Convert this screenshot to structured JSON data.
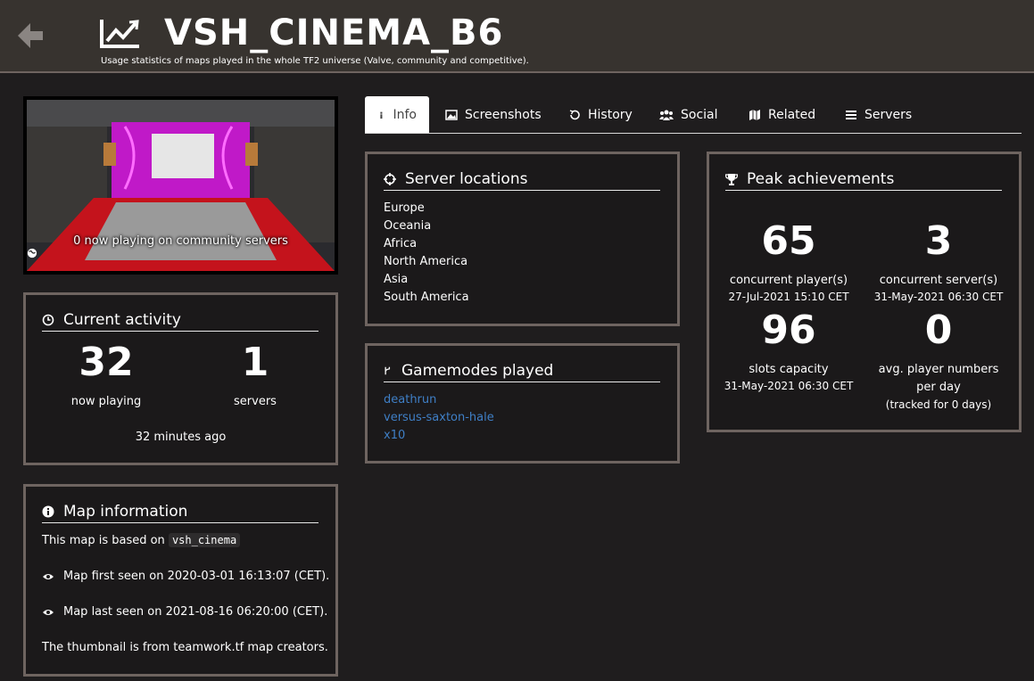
{
  "header": {
    "title": "VSH_CINEMA_B6",
    "subtitle": "Usage statistics of maps played in the whole TF2 universe (Valve, community and competitive).",
    "back_icon": "arrow-left-icon",
    "logo_icon": "line-chart-icon"
  },
  "thumbnail": {
    "caption": "0 now playing on community servers",
    "caption_icon": "globe-icon"
  },
  "current_activity": {
    "title": "Current activity",
    "players_value": "32",
    "players_label": "now playing",
    "servers_value": "1",
    "servers_label": "servers",
    "updated": "32 minutes ago"
  },
  "map_info": {
    "title": "Map information",
    "based_on_prefix": "This map is based on",
    "based_on": "vsh_cinema",
    "first_seen": "Map first seen on 2020-03-01 16:13:07 (CET).",
    "last_seen": "Map last seen on 2021-08-16 06:20:00 (CET).",
    "thumbnail_credit": "The thumbnail is from teamwork.tf map creators."
  },
  "tabs": [
    {
      "label": "Info",
      "icon": "info-icon",
      "active": true
    },
    {
      "label": "Screenshots",
      "icon": "image-icon"
    },
    {
      "label": "History",
      "icon": "history-icon"
    },
    {
      "label": "Social",
      "icon": "users-icon"
    },
    {
      "label": "Related",
      "icon": "map-icon"
    },
    {
      "label": "Servers",
      "icon": "server-list-icon"
    }
  ],
  "server_locations": {
    "title": "Server locations",
    "items": [
      "Europe",
      "Oceania",
      "Africa",
      "North America",
      "Asia",
      "South America"
    ]
  },
  "gamemodes": {
    "title": "Gamemodes played",
    "items": [
      "deathrun",
      "versus-saxton-hale",
      "x10"
    ]
  },
  "peak": {
    "title": "Peak achievements",
    "concurrent_players": {
      "value": "65",
      "label": "concurrent player(s)",
      "date": "27-Jul-2021 15:10 CET"
    },
    "concurrent_servers": {
      "value": "3",
      "label": "concurrent server(s)",
      "date": "31-May-2021 06:30 CET"
    },
    "slots": {
      "value": "96",
      "label": "slots capacity",
      "date": "31-May-2021 06:30 CET"
    },
    "avg_players": {
      "value": "0",
      "label": "avg. player numbers",
      "label2": "per day",
      "note": "(tracked for 0 days)"
    }
  },
  "colors": {
    "background": "#1f1d1e",
    "header": "#37332f",
    "panel_border": "#6e6460",
    "link": "#3f7fc6"
  }
}
